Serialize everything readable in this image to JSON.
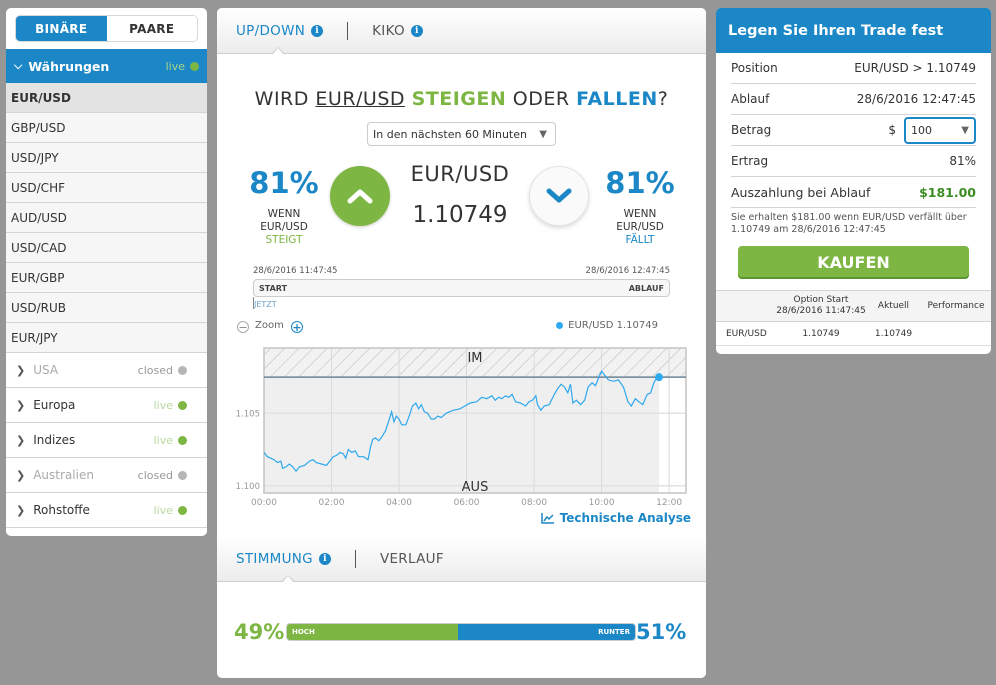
{
  "sidebar": {
    "segments": [
      "BINÄRE",
      "PAARE"
    ],
    "open_category": {
      "label": "Währungen",
      "status": "live"
    },
    "pairs": [
      "EUR/USD",
      "GBP/USD",
      "USD/JPY",
      "USD/CHF",
      "AUD/USD",
      "USD/CAD",
      "EUR/GBP",
      "USD/RUB",
      "EUR/JPY"
    ],
    "selected_pair": "EUR/USD",
    "categories": [
      {
        "label": "USA",
        "status": "closed"
      },
      {
        "label": "Europa",
        "status": "live"
      },
      {
        "label": "Indizes",
        "status": "live"
      },
      {
        "label": "Australien",
        "status": "closed"
      },
      {
        "label": "Rohstoffe",
        "status": "live"
      }
    ]
  },
  "main": {
    "tabs": [
      "UP/DOWN",
      "KIKO"
    ],
    "question": {
      "prefix": "WIRD ",
      "asset": "EUR/USD",
      "up": "STEIGEN",
      "mid": " ODER ",
      "down": "FALLEN",
      "suffix": "?"
    },
    "time_select": "In den nächsten 60 Minuten",
    "up": {
      "pct": "81%",
      "line1": "WENN",
      "line2": "EUR/USD",
      "line3": "STEIGT"
    },
    "down": {
      "pct": "81%",
      "line1": "WENN",
      "line2": "EUR/USD",
      "line3": "FÄLLT"
    },
    "symbol": "EUR/USD",
    "price": "1.10749",
    "timeline": {
      "start_time": "28/6/2016 11:47:45",
      "end_time": "28/6/2016 12:47:45",
      "start": "START",
      "end": "ABLAUF",
      "now": "JETZT"
    },
    "zoom_label": "Zoom",
    "legend": "EUR/USD 1.10749",
    "technical_analysis": "Technische Analyse",
    "bottom_tabs": [
      "STIMMUNG",
      "VERLAUF"
    ],
    "sentiment": {
      "up_pct": "49%",
      "down_pct": "51%",
      "up_label": "HOCH",
      "down_label": "RUNTER",
      "up_value": 49
    }
  },
  "chart_data": {
    "type": "line",
    "series": [
      {
        "name": "EUR/USD",
        "current": 1.10749
      }
    ],
    "x_ticks": [
      "00:00",
      "02:00",
      "04:00",
      "06:00",
      "08:00",
      "10:00",
      "12:00"
    ],
    "y_ticks": [
      "1.100",
      "1.105"
    ],
    "ylim": [
      1.0995,
      1.1095
    ],
    "xlim_hours": [
      0,
      12.5
    ],
    "strike": 1.10749,
    "zone_labels": {
      "in": "IM",
      "out": "AUS"
    },
    "points": [
      [
        0.0,
        1.1023
      ],
      [
        0.1,
        1.102
      ],
      [
        0.2,
        1.1019
      ],
      [
        0.3,
        1.1018
      ],
      [
        0.4,
        1.1016
      ],
      [
        0.5,
        1.1017
      ],
      [
        0.55,
        1.1012
      ],
      [
        0.65,
        1.1013
      ],
      [
        0.75,
        1.1015
      ],
      [
        0.85,
        1.1013
      ],
      [
        0.95,
        1.101
      ],
      [
        1.05,
        1.1013
      ],
      [
        1.2,
        1.1014
      ],
      [
        1.35,
        1.1017
      ],
      [
        1.45,
        1.1018
      ],
      [
        1.55,
        1.1016
      ],
      [
        1.7,
        1.1015
      ],
      [
        1.85,
        1.1014
      ],
      [
        1.95,
        1.1017
      ],
      [
        2.05,
        1.102
      ],
      [
        2.15,
        1.1021
      ],
      [
        2.25,
        1.1023
      ],
      [
        2.35,
        1.1022
      ],
      [
        2.42,
        1.1019
      ],
      [
        2.5,
        1.1025
      ],
      [
        2.6,
        1.1023
      ],
      [
        2.7,
        1.1024
      ],
      [
        2.8,
        1.102
      ],
      [
        2.95,
        1.102
      ],
      [
        3.08,
        1.1018
      ],
      [
        3.15,
        1.1026
      ],
      [
        3.22,
        1.1032
      ],
      [
        3.3,
        1.1033
      ],
      [
        3.4,
        1.1031
      ],
      [
        3.5,
        1.1034
      ],
      [
        3.6,
        1.1038
      ],
      [
        3.7,
        1.1045
      ],
      [
        3.78,
        1.1051
      ],
      [
        3.85,
        1.1044
      ],
      [
        3.92,
        1.1048
      ],
      [
        4.0,
        1.1046
      ],
      [
        4.08,
        1.1042
      ],
      [
        4.2,
        1.1042
      ],
      [
        4.3,
        1.1048
      ],
      [
        4.4,
        1.1055
      ],
      [
        4.5,
        1.1057
      ],
      [
        4.58,
        1.1053
      ],
      [
        4.66,
        1.1056
      ],
      [
        4.75,
        1.1051
      ],
      [
        4.85,
        1.105
      ],
      [
        4.95,
        1.1046
      ],
      [
        5.05,
        1.1046
      ],
      [
        5.15,
        1.1048
      ],
      [
        5.25,
        1.1047
      ],
      [
        5.4,
        1.105
      ],
      [
        5.6,
        1.1052
      ],
      [
        5.8,
        1.1053
      ],
      [
        5.95,
        1.1055
      ],
      [
        6.1,
        1.1057
      ],
      [
        6.3,
        1.1058
      ],
      [
        6.45,
        1.1061
      ],
      [
        6.6,
        1.106
      ],
      [
        6.75,
        1.1062
      ],
      [
        6.85,
        1.1059
      ],
      [
        6.95,
        1.1061
      ],
      [
        7.05,
        1.106
      ],
      [
        7.15,
        1.1062
      ],
      [
        7.25,
        1.1061
      ],
      [
        7.35,
        1.1063
      ],
      [
        7.45,
        1.1058
      ],
      [
        7.6,
        1.1057
      ],
      [
        7.75,
        1.1055
      ],
      [
        7.85,
        1.1058
      ],
      [
        7.95,
        1.1059
      ],
      [
        8.05,
        1.1062
      ],
      [
        8.1,
        1.1056
      ],
      [
        8.2,
        1.1052
      ],
      [
        8.3,
        1.1055
      ],
      [
        8.45,
        1.1056
      ],
      [
        8.6,
        1.1063
      ],
      [
        8.7,
        1.1067
      ],
      [
        8.8,
        1.107
      ],
      [
        8.9,
        1.1068
      ],
      [
        9.0,
        1.1064
      ],
      [
        9.08,
        1.107
      ],
      [
        9.15,
        1.1057
      ],
      [
        9.25,
        1.1059
      ],
      [
        9.38,
        1.1056
      ],
      [
        9.5,
        1.1059
      ],
      [
        9.6,
        1.1068
      ],
      [
        9.72,
        1.1071
      ],
      [
        9.82,
        1.1069
      ],
      [
        9.92,
        1.1075
      ],
      [
        10.0,
        1.1079
      ],
      [
        10.1,
        1.1076
      ],
      [
        10.2,
        1.1073
      ],
      [
        10.35,
        1.1072
      ],
      [
        10.5,
        1.1073
      ],
      [
        10.65,
        1.1068
      ],
      [
        10.78,
        1.1058
      ],
      [
        10.88,
        1.1055
      ],
      [
        11.0,
        1.106
      ],
      [
        11.1,
        1.1058
      ],
      [
        11.22,
        1.1056
      ],
      [
        11.35,
        1.1063
      ],
      [
        11.45,
        1.1064
      ],
      [
        11.55,
        1.1071
      ],
      [
        11.62,
        1.1074
      ],
      [
        11.7,
        1.10749
      ]
    ]
  },
  "trade_panel": {
    "title": "Legen Sie Ihren Trade fest",
    "rows": [
      {
        "label": "Position",
        "value": "EUR/USD > 1.10749"
      },
      {
        "label": "Ablauf",
        "value": "28/6/2016 12:47:45"
      }
    ],
    "amount": {
      "label": "Betrag",
      "currency": "$",
      "value": "100"
    },
    "yield": {
      "label": "Ertrag",
      "value": "81%"
    },
    "payout": {
      "label": "Auszahlung bei Ablauf",
      "value": "$181.00"
    },
    "note": "Sie erhalten $181.00 wenn EUR/USD verfällt über 1.10749 am 28/6/2016 12:47:45",
    "buy_label": "KAUFEN",
    "table": {
      "headers": [
        "",
        "Option Start\n28/6/2016 11:47:45",
        "Aktuell",
        "Performance"
      ],
      "header_line1": "Option Start",
      "header_line2": "28/6/2016 11:47:45",
      "rows": [
        [
          "EUR/USD",
          "1.10749",
          "1.10749",
          ""
        ]
      ]
    }
  },
  "colors": {
    "blue": "#1b87c6",
    "green": "#7db643",
    "line": "#2ea8ee"
  }
}
